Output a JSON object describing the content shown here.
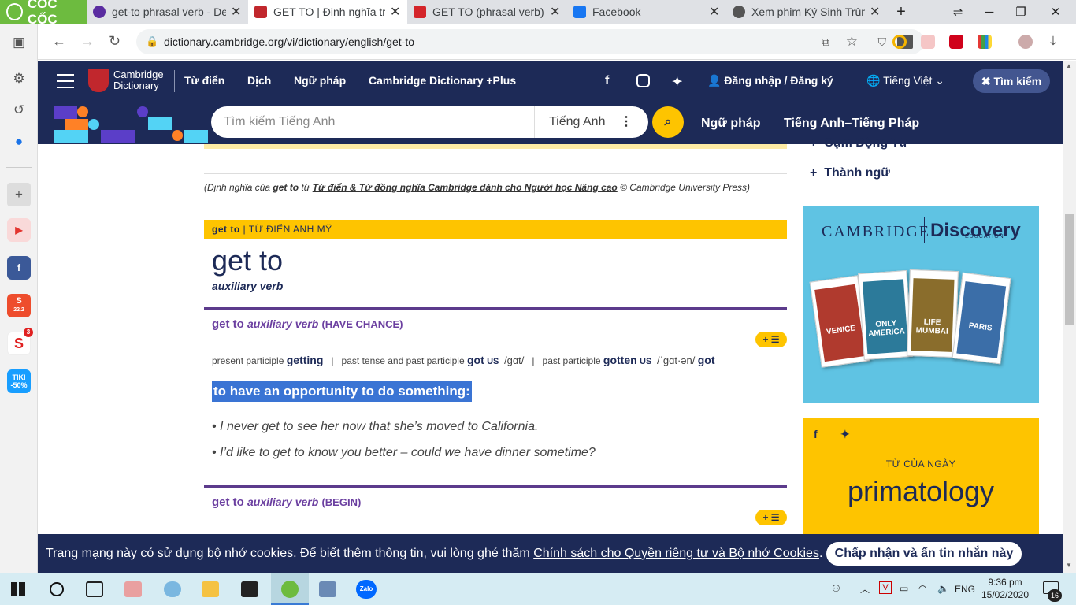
{
  "browser": {
    "brand": "CỐC CỐC",
    "tabs": [
      {
        "label": "get-to phrasal verb - De",
        "color": "#5a2ca0",
        "active": false
      },
      {
        "label": "GET TO | Định nghĩa tro",
        "color": "#c1272d",
        "active": true
      },
      {
        "label": "GET TO (phrasal verb) đ",
        "color": "#d4242a",
        "active": false
      },
      {
        "label": "Facebook",
        "color": "#1877f2",
        "active": false
      },
      {
        "label": "Xem phim Ký Sinh Trùng",
        "color": "#555555",
        "active": false
      }
    ],
    "new_tab": "+",
    "url": "dictionary.cambridge.org/vi/dictionary/english/get-to"
  },
  "sidebar": {
    "items": [
      {
        "name": "youtube",
        "color": "#e3342f",
        "label": "▶"
      },
      {
        "name": "facebook",
        "color": "#3b5998",
        "label": "f"
      },
      {
        "name": "shopee",
        "color": "#ee4d2d",
        "label": "S"
      },
      {
        "name": "sendo",
        "color": "#e02020",
        "label": "S",
        "badge": "3"
      },
      {
        "name": "tiki",
        "color": "#189eff",
        "label": "TIKI -50%"
      }
    ],
    "shopee_badge": "22.2"
  },
  "site": {
    "logo": {
      "line1": "Cambridge",
      "line2": "Dictionary"
    },
    "topnav": [
      "Từ điển",
      "Dịch",
      "Ngữ pháp",
      "Cambridge Dictionary +Plus"
    ],
    "login": "Đăng nhập / Đăng ký",
    "language": "Tiếng Việt",
    "search_toggle": "Tìm kiếm",
    "search": {
      "placeholder": "Tìm kiếm Tiếng Anh",
      "dictionary": "Tiếng Anh"
    },
    "secnav": [
      "Ngữ pháp",
      "Tiếng Anh–Tiếng Pháp"
    ]
  },
  "content": {
    "source": {
      "prefix": "(Định nghĩa của ",
      "term": "get to",
      "mid": " từ ",
      "link": "Từ điển & Từ đồng nghĩa Cambridge dành cho Người học Nâng cao",
      "suffix": " © Cambridge University Press)"
    },
    "entry_header": {
      "term": "get to",
      "label": " | TỪ ĐIỂN ANH MỸ"
    },
    "headword": "get to",
    "pos": "auxiliary verb",
    "senses": [
      {
        "term": "get to",
        "pos": "auxiliary verb",
        "guide": "(HAVE CHANCE)"
      },
      {
        "term": "get to",
        "pos": "auxiliary verb",
        "guide": "(BEGIN)"
      }
    ],
    "plus_list": "+ ☰",
    "forms": {
      "pp_label": "present participle",
      "pp": "getting",
      "pt_label": "past tense and past participle",
      "pt": "got",
      "pt_region": "US",
      "pt_ipa": "/ɡɑt/",
      "past_part_label": "past participle",
      "past_part": "gotten",
      "past_part_region": "US",
      "past_part_ipa": "/ˈɡɑt·ən/",
      "alt": "got",
      "sep": "|"
    },
    "definition": "to have an opportunity to do something:",
    "examples": [
      "I never get to see her now that she’s moved to California.",
      "I’d like to get to know you better – could we have dinner sometime?"
    ]
  },
  "right": {
    "links": [
      "Cụm Động Từ",
      "Thành ngữ"
    ],
    "ad": {
      "brand1": "CAMBRIDGE",
      "brand2": "Discovery",
      "brand2_sub": "EDUCATION",
      "books": [
        "VENICE",
        "ONLY AMERICA",
        "LIFE MUMBAI",
        "PARIS"
      ]
    },
    "wotd": {
      "caption": "TỪ CỦA NGÀY",
      "word": "primatology"
    }
  },
  "cookie": {
    "message": "Trang mạng này có sử dụng bộ nhớ cookies. Để biết thêm thông tin, vui lòng ghé thăm ",
    "link": "Chính sách cho Quyền riêng tư và Bộ nhớ Cookies",
    "end": ".",
    "accept": "Chấp nhận và ẩn tin nhắn này"
  },
  "taskbar": {
    "lang": "ENG",
    "time": "9:36 pm",
    "date": "15/02/2020",
    "notif": "16",
    "zalo": "Zalo"
  },
  "colors": {
    "navy": "#1d2a57",
    "yellow": "#fec400",
    "purple": "#6b3fa0",
    "highlight": "#3a74d4"
  }
}
